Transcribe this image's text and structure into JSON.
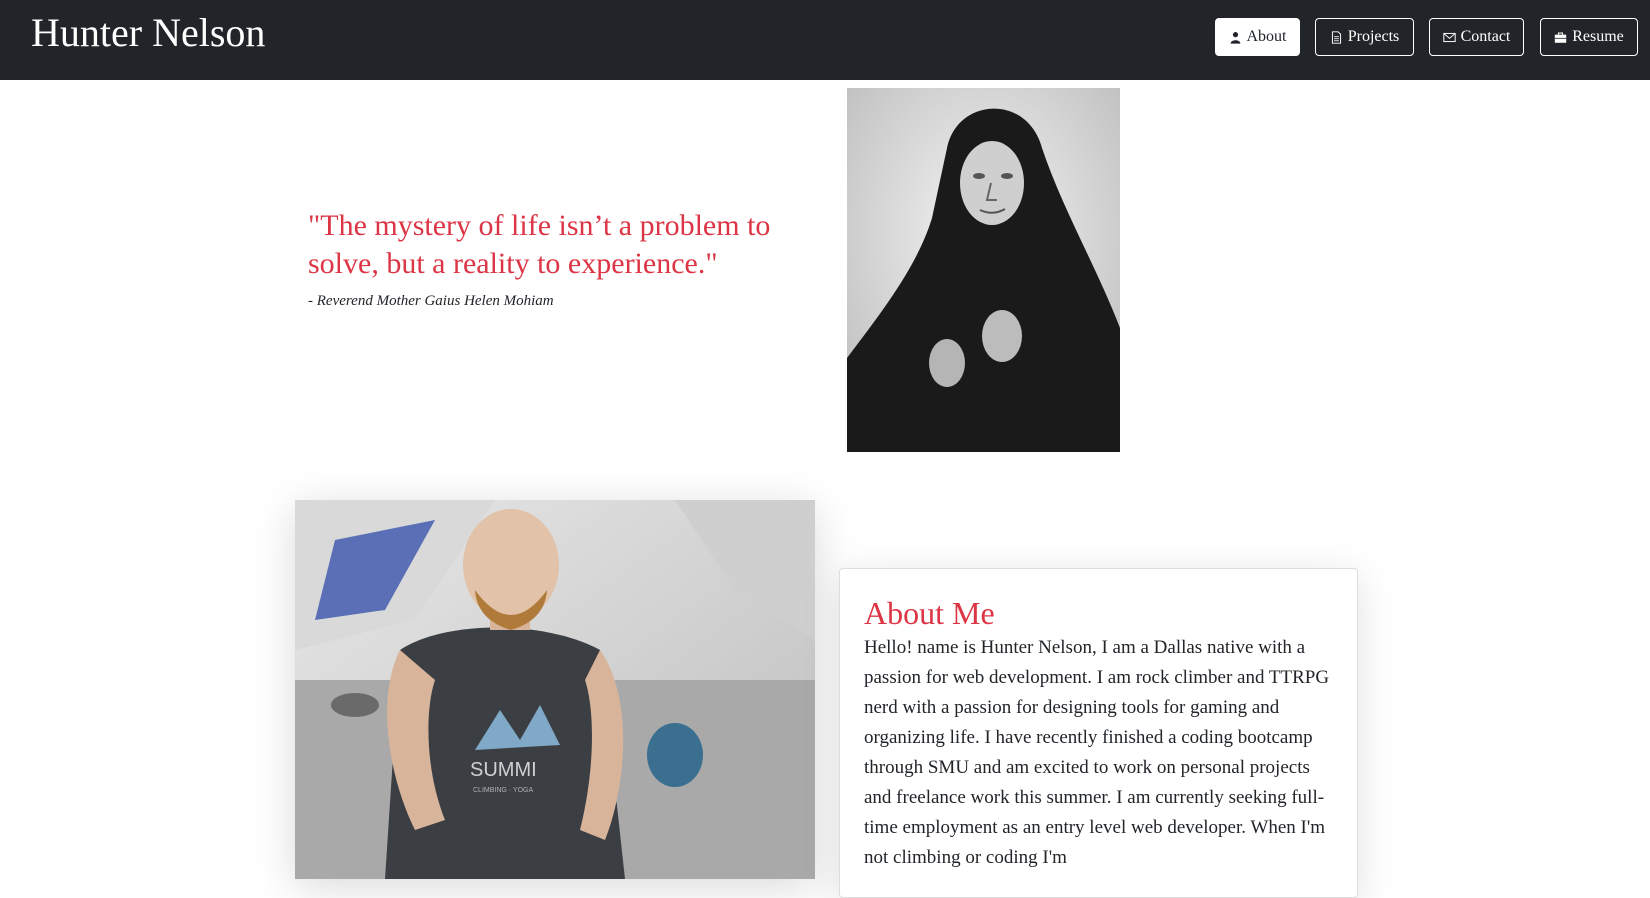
{
  "header": {
    "brand": "Hunter Nelson",
    "nav": [
      {
        "label": "About",
        "icon": "person-icon",
        "active": true
      },
      {
        "label": "Projects",
        "icon": "document-icon",
        "active": false
      },
      {
        "label": "Contact",
        "icon": "envelope-icon",
        "active": false
      },
      {
        "label": "Resume",
        "icon": "briefcase-icon",
        "active": false
      }
    ]
  },
  "quote": {
    "text": "\"The mystery of life isn’t a problem to solve, but a reality to experience.\"",
    "author": "- Reverend Mother Gaius Helen Mohiam"
  },
  "about": {
    "title": "About Me",
    "body": "Hello! name is Hunter Nelson, I am a Dallas native with a passion for web development. I am rock climber and TTRPG nerd with a passion for designing tools for gaming and organizing life. I have recently finished a coding bootcamp through SMU and am excited to work on personal projects and freelance work this summer. I am currently seeking full-time employment as an entry level web developer. When I'm not climbing or coding I'm"
  },
  "photo": {
    "shirt_text": "SUMMI",
    "shirt_subtext": "CLIMBING · YOGA"
  },
  "colors": {
    "navbar": "#212529",
    "accent": "#dc3545"
  }
}
